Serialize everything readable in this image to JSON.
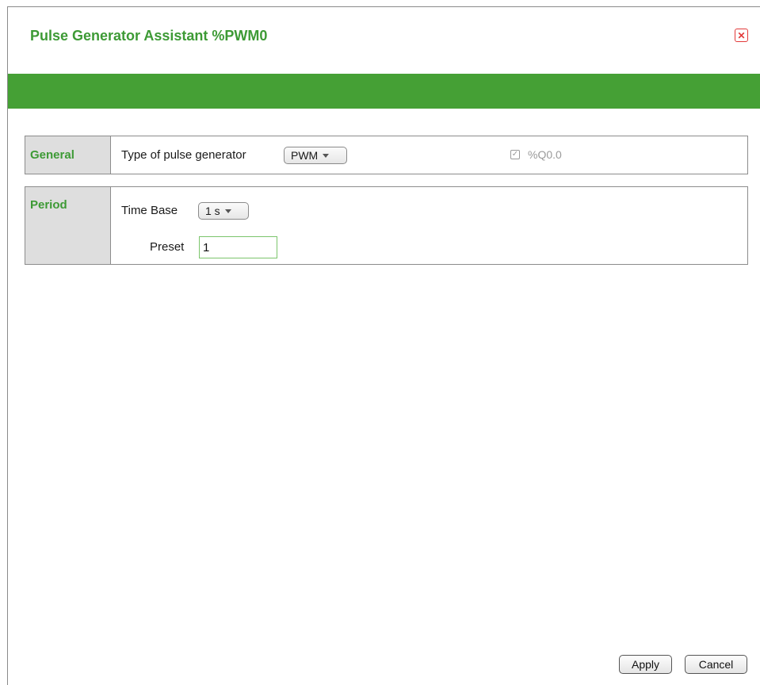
{
  "dialog": {
    "title": "Pulse Generator Assistant %PWM0",
    "close_icon": "close-icon",
    "close_glyph": "✕",
    "accent_color": "#45a035",
    "close_color": "#e23a3a"
  },
  "general": {
    "label": "General",
    "type_label": "Type of pulse generator",
    "type_value": "PWM",
    "output_checked": true,
    "output_label": "%Q0.0"
  },
  "period": {
    "label": "Period",
    "time_base_label": "Time Base",
    "time_base_value": "1 s",
    "preset_label": "Preset",
    "preset_value": "1"
  },
  "buttons": {
    "apply": "Apply",
    "cancel": "Cancel"
  }
}
